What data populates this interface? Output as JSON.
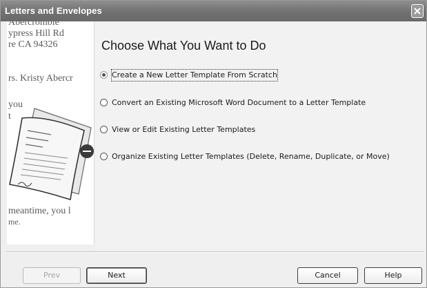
{
  "window": {
    "title": "Letters and Envelopes",
    "close_icon": "close-icon"
  },
  "illustration": {
    "address_lines": [
      "Abercrombie",
      "ypress Hill Rd",
      "re CA 94326"
    ],
    "salutation": "rs. Kristy Abercr",
    "body_fragments": [
      "you",
      "t",
      "meantime, you l",
      "me."
    ]
  },
  "main": {
    "heading": "Choose What You Want to Do",
    "options": [
      {
        "label": "Create a New Letter Template From Scratch",
        "selected": true
      },
      {
        "label": "Convert an Existing Microsoft Word Document to a Letter Template",
        "selected": false
      },
      {
        "label": "View or Edit Existing Letter Templates",
        "selected": false
      },
      {
        "label": "Organize Existing Letter Templates (Delete, Rename, Duplicate, or Move)",
        "selected": false
      }
    ]
  },
  "buttons": {
    "prev": "Prev",
    "next": "Next",
    "cancel": "Cancel",
    "help": "Help"
  }
}
